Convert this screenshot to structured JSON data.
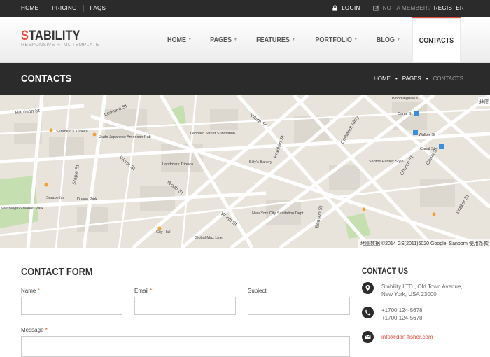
{
  "topbar": {
    "links": [
      "HOME",
      "PRICING",
      "FAQS"
    ],
    "login": "LOGIN",
    "not_member": "NOT A MEMBER?",
    "register": "REGISTER"
  },
  "header": {
    "logo_first": "S",
    "logo_rest": "TABILITY",
    "tagline": "RESPONSIVE HTML TEMPLATE",
    "nav": [
      "HOME",
      "PAGES",
      "FEATURES",
      "PORTFOLIO",
      "BLOG",
      "CONTACTS"
    ],
    "active": "CONTACTS"
  },
  "titlebar": {
    "title": "CONTACTS",
    "crumbs": [
      "HOME",
      "PAGES",
      "CONTACTS"
    ]
  },
  "map": {
    "streets": [
      "Harrison St",
      "Leonard St",
      "White St",
      "Worth St",
      "Worth St",
      "Worth St",
      "Franklin St",
      "Staple St",
      "Church St",
      "Cortlandt Alley",
      "Benson St",
      "Canal St",
      "Walker St"
    ],
    "places": [
      "Sarabeth's Tribeca",
      "Zutto Japanese American Pub",
      "Leonard Street Substation",
      "Landmark Tribeca",
      "Billy's Bakery",
      "Bloomingdale's",
      "Washington Market Park",
      "Duane Park",
      "Sarabeth's",
      "City Hall",
      "Global Max Line",
      "New York City Sanitation Dept",
      "Santos Parties Style",
      "Canal St",
      "Walker St",
      "Canal St"
    ],
    "corner": "地图",
    "attribution": "地图数据 ©2014 GS(2011)6020 Google, Sanborn  使用条款  报"
  },
  "form": {
    "title": "CONTACT FORM",
    "name_label": "Name",
    "email_label": "Email",
    "subject_label": "Subject",
    "message_label": "Message",
    "required_mark": "*"
  },
  "contact": {
    "title": "CONTACT US",
    "address_line1": "Stability LTD., Old Town Avenue,",
    "address_line2": "New York, USA 23000",
    "phone1": "+1700 124-5678",
    "phone2": "+1700 124-5678",
    "email": "info@dan-fisher.com"
  },
  "colors": {
    "accent": "#e74c3c",
    "dark": "#2b2b2b"
  }
}
